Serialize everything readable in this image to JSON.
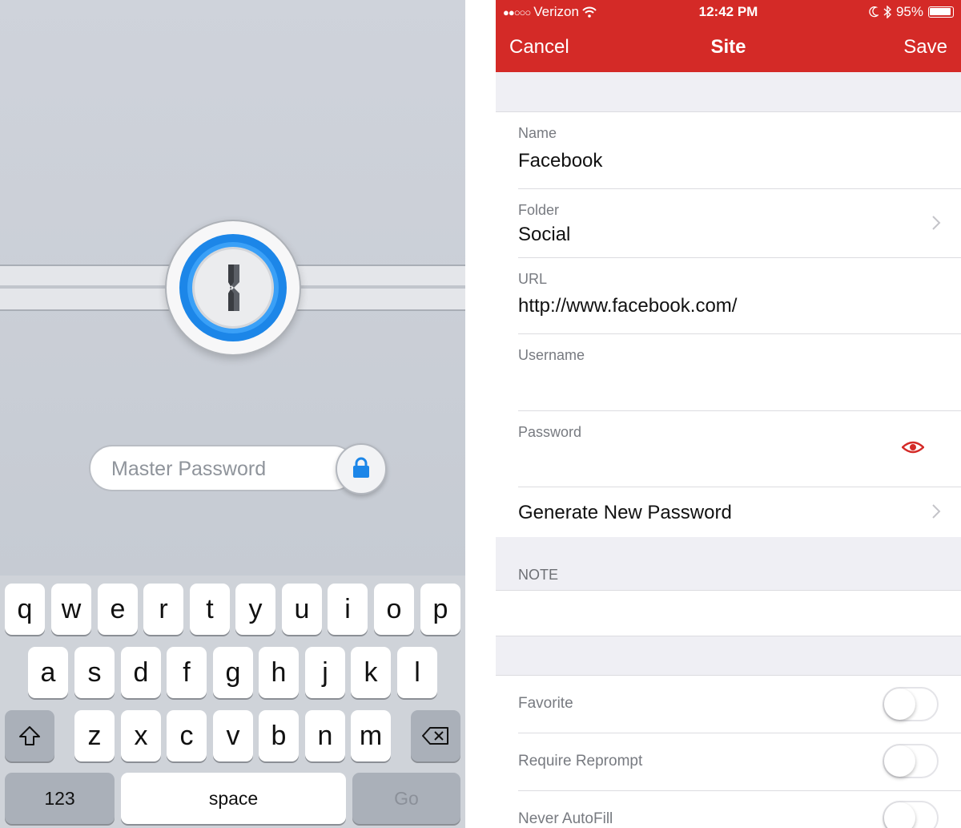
{
  "lockscreen": {
    "password_placeholder": "Master Password",
    "keyboard": {
      "row1": [
        "q",
        "w",
        "e",
        "r",
        "t",
        "y",
        "u",
        "i",
        "o",
        "p"
      ],
      "row2": [
        "a",
        "s",
        "d",
        "f",
        "g",
        "h",
        "j",
        "k",
        "l"
      ],
      "row3": [
        "z",
        "x",
        "c",
        "v",
        "b",
        "n",
        "m"
      ],
      "numbers_key": "123",
      "space_key": "space",
      "go_key": "Go"
    }
  },
  "status_bar": {
    "carrier": "Verizon",
    "time": "12:42 PM",
    "battery": "95%"
  },
  "nav": {
    "cancel": "Cancel",
    "title": "Site",
    "save": "Save"
  },
  "form": {
    "name_label": "Name",
    "name_value": "Facebook",
    "folder_label": "Folder",
    "folder_value": "Social",
    "url_label": "URL",
    "url_value": "http://www.facebook.com/",
    "username_label": "Username",
    "username_value": "",
    "password_label": "Password",
    "password_value": "",
    "generate_label": "Generate New Password",
    "note_header": "NOTE",
    "favorite_label": "Favorite",
    "reprompt_label": "Require Reprompt",
    "autofill_label": "Never AutoFill"
  },
  "colors": {
    "brand_red": "#d42a27",
    "accent_blue": "#1c86e8"
  }
}
